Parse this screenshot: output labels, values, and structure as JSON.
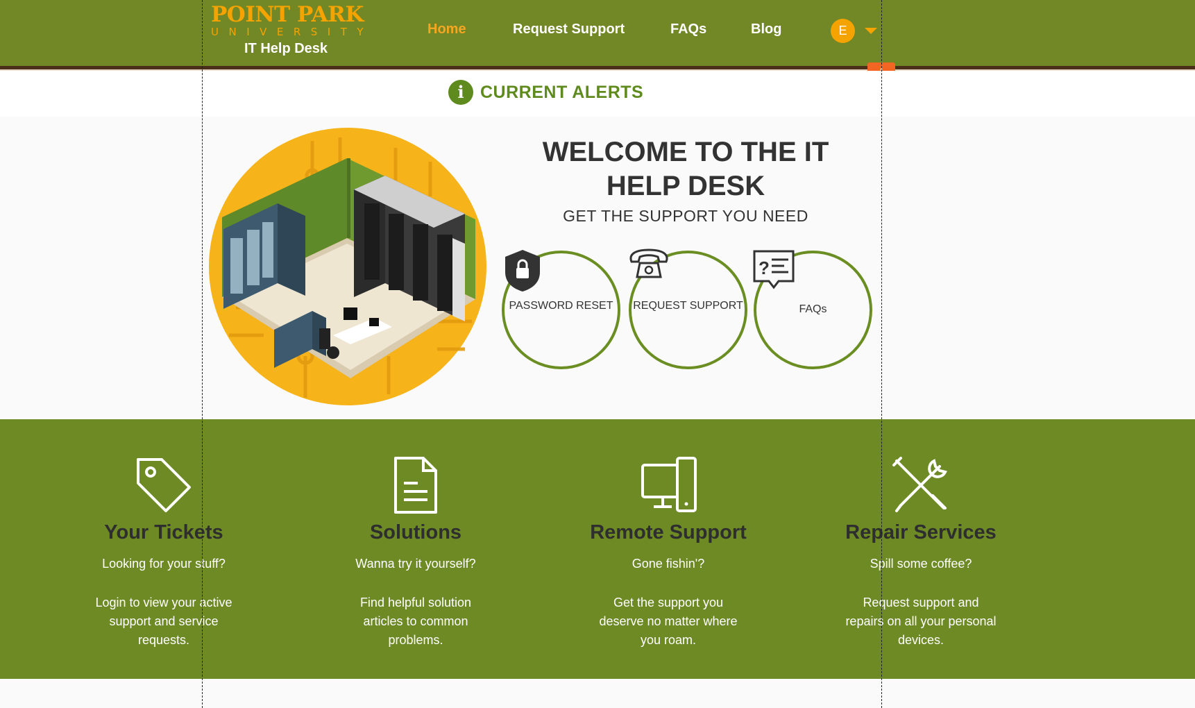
{
  "header": {
    "logo": {
      "main": "POINT PARK",
      "sub": "UNIVERSITY",
      "site": "IT Help Desk"
    },
    "nav": [
      {
        "label": "Home",
        "active": true
      },
      {
        "label": "Request Support",
        "active": false
      },
      {
        "label": "FAQs",
        "active": false
      },
      {
        "label": "Blog",
        "active": false
      }
    ],
    "user_initial": "E",
    "resize_glyph": "↕"
  },
  "alerts": {
    "icon_glyph": "i",
    "label": "CURRENT ALERTS"
  },
  "hero": {
    "title": "WELCOME TO THE IT HELP DESK",
    "subtitle": "GET THE SUPPORT YOU NEED",
    "actions": [
      {
        "label": "PASSWORD RESET",
        "icon": "lock-shield-icon"
      },
      {
        "label": "REQUEST SUPPORT",
        "icon": "telephone-icon"
      },
      {
        "label": "FAQs",
        "icon": "faq-speech-bubble-icon"
      }
    ]
  },
  "features": [
    {
      "title": "Your Tickets",
      "tagline": "Looking for your stuff?",
      "description": "Login to view your active support and service requests.",
      "icon": "tag-icon"
    },
    {
      "title": "Solutions",
      "tagline": "Wanna try it yourself?",
      "description": "Find helpful solution articles to common problems.",
      "icon": "document-icon"
    },
    {
      "title": "Remote Support",
      "tagline": "Gone fishin'?",
      "description": "Get the support you deserve no matter where you roam.",
      "icon": "devices-icon"
    },
    {
      "title": "Repair Services",
      "tagline": "Spill some coffee?",
      "description": "Request support and repairs on all your personal devices.",
      "icon": "tools-icon"
    }
  ],
  "colors": {
    "header_green": "#728826",
    "accent_orange": "#f5a300",
    "feature_green": "#6d8a25",
    "alert_green": "#5f8a1e"
  }
}
